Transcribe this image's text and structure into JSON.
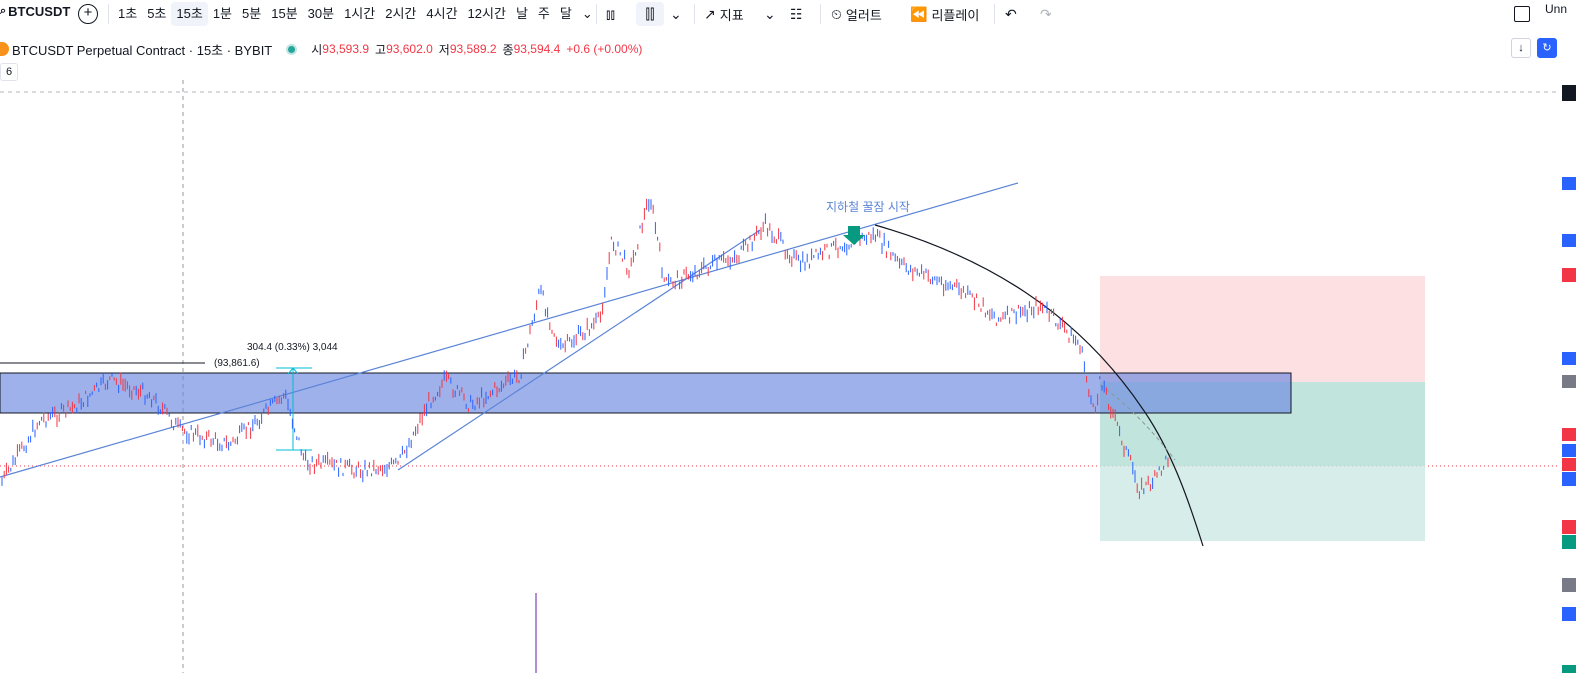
{
  "toolbar": {
    "symbol": "BTCUSDT",
    "add_symbol": "+",
    "intervals": [
      "1초",
      "5초",
      "15초",
      "1분",
      "5분",
      "15분",
      "30분",
      "1시간",
      "2시간",
      "4시간",
      "12시간",
      "날",
      "주",
      "달"
    ],
    "active_interval": "15초",
    "indicators_label": "지표",
    "alert_label": "얼러트",
    "replay_label": "리플레이",
    "right_label": "Unn"
  },
  "legend": {
    "title": "BTCUSDT Perpetual Contract · 15초 · BYBIT",
    "open_label": "시",
    "open_value": "93,593.9",
    "high_label": "고",
    "high_value": "93,602.0",
    "low_label": "저",
    "low_value": "93,589.2",
    "close_label": "종",
    "close_value": "93,594.4",
    "change": "+0.6 (+0.00%)",
    "collapse_count": "6"
  },
  "drawings": {
    "annotation_text": "지하철 꿀잠 시작",
    "measure_text": "304.4 (0.33%) 3,044",
    "price_label": "(93,861.6)"
  },
  "colors": {
    "up": "#f23645",
    "down": "#2962ff",
    "zone": "#6a87e0",
    "arrow": "#089981",
    "stop_zone": "#fbd8db",
    "target_zone": "#cde9e3",
    "annotation": "#5b84d6"
  },
  "icons": [
    "search-icon",
    "plus-circle-icon",
    "chevron-down-icon",
    "bar-chart-icon",
    "candle-icon",
    "indicators-icon",
    "layout-grid-icon",
    "alert-clock-icon",
    "replay-icon",
    "undo-icon",
    "redo-icon",
    "fullscreen-icon",
    "scroll-down-icon",
    "sync-icon"
  ]
}
